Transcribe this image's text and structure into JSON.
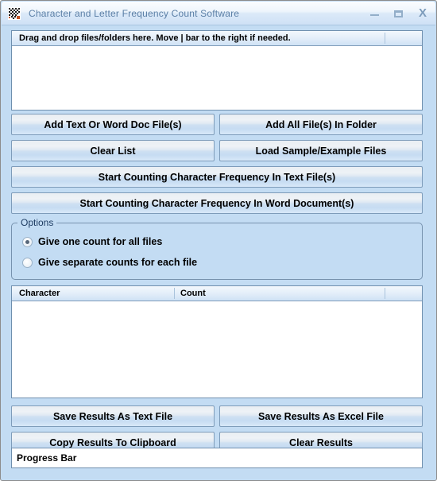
{
  "window": {
    "title": "Character and Letter Frequency Count Software",
    "icon": "app-icon",
    "controls": {
      "minimize": "minimize-icon",
      "maximize": "maximize-icon",
      "close": "X"
    }
  },
  "file_list": {
    "header_label": "Drag and drop files/folders here. Move | bar to the right if needed.",
    "rows": []
  },
  "buttons": {
    "add_text_or_word": "Add Text Or Word Doc File(s)",
    "add_all_in_folder": "Add All File(s) In Folder",
    "clear_list": "Clear List",
    "load_sample": "Load Sample/Example Files",
    "start_text_files": "Start Counting Character Frequency In Text File(s)",
    "start_word_docs": "Start Counting Character Frequency In Word Document(s)",
    "save_text": "Save Results As Text File",
    "save_excel": "Save Results As Excel File",
    "copy_clipboard": "Copy Results To Clipboard",
    "clear_results": "Clear Results"
  },
  "options": {
    "legend": "Options",
    "items": [
      {
        "label": "Give one count for all files",
        "checked": true
      },
      {
        "label": "Give separate counts for each file",
        "checked": false
      }
    ]
  },
  "results": {
    "columns": [
      "Character",
      "Count"
    ],
    "rows": []
  },
  "progress": {
    "label": "Progress Bar",
    "value": 0
  },
  "colors": {
    "window_background": "#c3dcf3",
    "frame_border": "#8c8c8c",
    "control_border": "#6f8fae",
    "title_text": "#5b7fa6",
    "group_label": "#1f3d63"
  }
}
